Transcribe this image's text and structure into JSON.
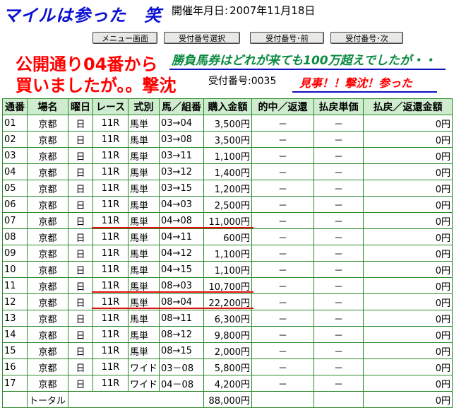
{
  "header": {
    "title": "マイルは参った　笑",
    "date_label": "開催年月日:",
    "date_value": "2007年11月18日"
  },
  "buttons": {
    "menu": "メニュー画面",
    "select": "受付番号選択",
    "prev": "受付番号･前",
    "next": "受付番号･次"
  },
  "messages": {
    "red_line1": "公開通り04番から",
    "red_line2": "買いましたが。。撃沈",
    "blue_note": "勝負馬券はどれが来ても100万超えでしたが・・",
    "receipt_label": "受付番号:",
    "receipt_value": "0035",
    "red_note": "見事！！撃沈！参った"
  },
  "table": {
    "headers": [
      "通番",
      "場名",
      "曜日",
      "レース",
      "式別",
      "馬／組番",
      "購入金額",
      "的中／返還",
      "払戻単価",
      "払戻／返還金額"
    ],
    "rows": [
      [
        "01",
        "京都",
        "日",
        "11R",
        "馬単",
        "03→04",
        "3,500円",
        "－",
        "－",
        "0円"
      ],
      [
        "02",
        "京都",
        "日",
        "11R",
        "馬単",
        "03→08",
        "3,500円",
        "－",
        "－",
        "0円"
      ],
      [
        "03",
        "京都",
        "日",
        "11R",
        "馬単",
        "03→11",
        "1,100円",
        "－",
        "－",
        "0円"
      ],
      [
        "04",
        "京都",
        "日",
        "11R",
        "馬単",
        "03→12",
        "1,400円",
        "－",
        "－",
        "0円"
      ],
      [
        "05",
        "京都",
        "日",
        "11R",
        "馬単",
        "03→15",
        "1,200円",
        "－",
        "－",
        "0円"
      ],
      [
        "06",
        "京都",
        "日",
        "11R",
        "馬単",
        "04→03",
        "2,500円",
        "－",
        "－",
        "0円"
      ],
      [
        "07",
        "京都",
        "日",
        "11R",
        "馬単",
        "04→08",
        "11,000円",
        "－",
        "－",
        "0円"
      ],
      [
        "08",
        "京都",
        "日",
        "11R",
        "馬単",
        "04→11",
        "600円",
        "－",
        "－",
        "0円"
      ],
      [
        "09",
        "京都",
        "日",
        "11R",
        "馬単",
        "04→12",
        "1,100円",
        "－",
        "－",
        "0円"
      ],
      [
        "10",
        "京都",
        "日",
        "11R",
        "馬単",
        "04→15",
        "1,100円",
        "－",
        "－",
        "0円"
      ],
      [
        "11",
        "京都",
        "日",
        "11R",
        "馬単",
        "08→03",
        "10,700円",
        "－",
        "－",
        "0円"
      ],
      [
        "12",
        "京都",
        "日",
        "11R",
        "馬単",
        "08→04",
        "22,200円",
        "－",
        "－",
        "0円"
      ],
      [
        "13",
        "京都",
        "日",
        "11R",
        "馬単",
        "08→11",
        "6,300円",
        "－",
        "－",
        "0円"
      ],
      [
        "14",
        "京都",
        "日",
        "11R",
        "馬単",
        "08→12",
        "9,800円",
        "－",
        "－",
        "0円"
      ],
      [
        "15",
        "京都",
        "日",
        "11R",
        "馬単",
        "08→15",
        "2,000円",
        "－",
        "－",
        "0円"
      ],
      [
        "16",
        "京都",
        "日",
        "11R",
        "ワイド",
        "03－08",
        "5,800円",
        "－",
        "－",
        "0円"
      ],
      [
        "17",
        "京都",
        "日",
        "11R",
        "ワイド",
        "04－08",
        "4,200円",
        "－",
        "－",
        "0円"
      ]
    ],
    "total_label": "トータル",
    "total_amount": "88,000円",
    "total_payout": "0円"
  },
  "colors": {
    "title_blue": "#0a10d0",
    "header_green": "#cfeccf",
    "border_green": "#2a8a2a",
    "alert_red": "#ff0000"
  }
}
